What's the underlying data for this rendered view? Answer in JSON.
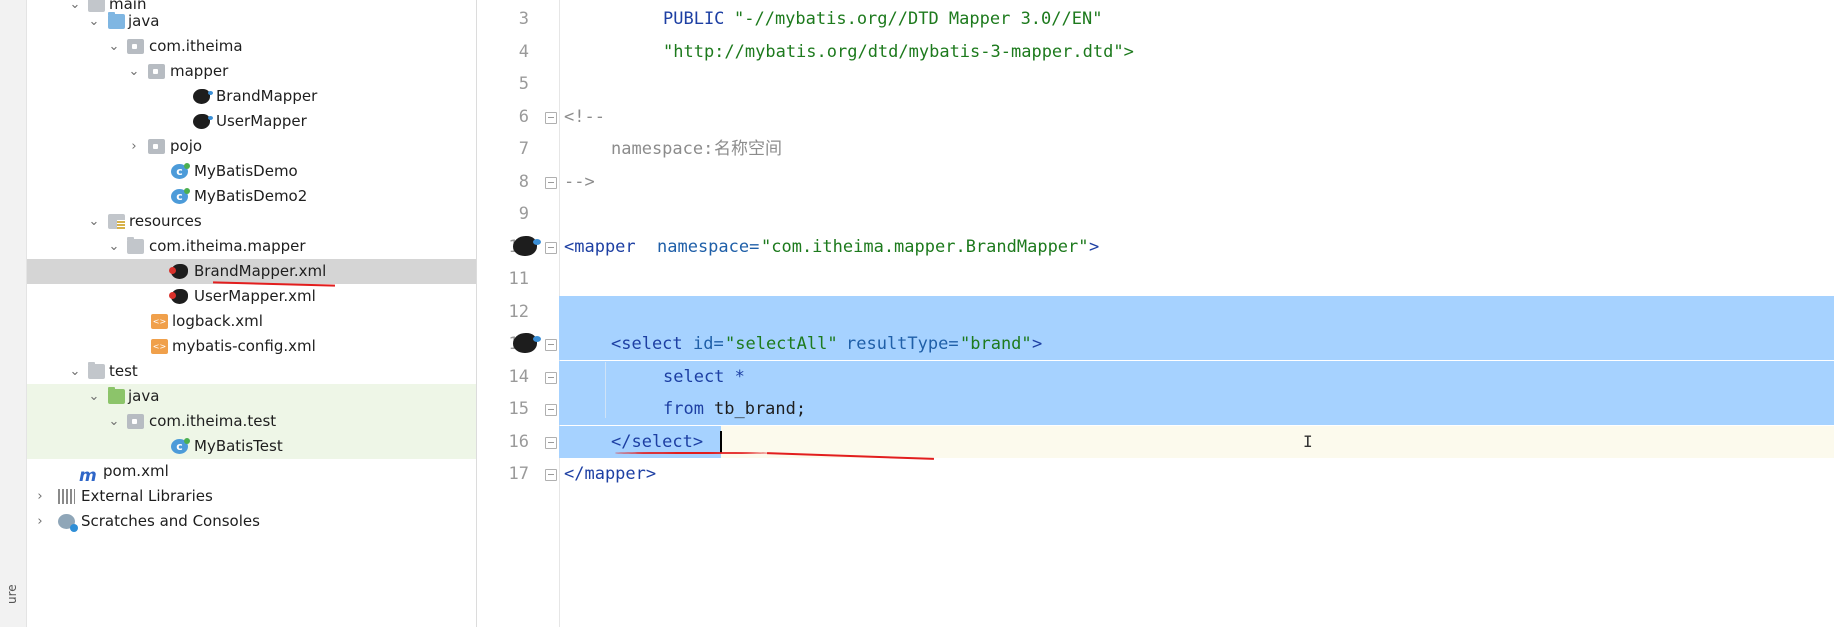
{
  "side_strip": {
    "label": "ure"
  },
  "tree": [
    {
      "label": "main",
      "depth": 0
    },
    {
      "label": "java",
      "depth": 1
    },
    {
      "label": "com.itheima",
      "depth": 2
    },
    {
      "label": "mapper",
      "depth": 3
    },
    {
      "label": "BrandMapper",
      "depth": 4
    },
    {
      "label": "UserMapper",
      "depth": 4
    },
    {
      "label": "pojo",
      "depth": 3
    },
    {
      "label": "MyBatisDemo",
      "depth": 3
    },
    {
      "label": "MyBatisDemo2",
      "depth": 3
    },
    {
      "label": "resources",
      "depth": 1
    },
    {
      "label": "com.itheima.mapper",
      "depth": 2
    },
    {
      "label": "BrandMapper.xml",
      "depth": 3,
      "selected": true
    },
    {
      "label": "UserMapper.xml",
      "depth": 3
    },
    {
      "label": "logback.xml",
      "depth": 2
    },
    {
      "label": "mybatis-config.xml",
      "depth": 2
    },
    {
      "label": "test",
      "depth": 0
    },
    {
      "label": "java",
      "depth": 1
    },
    {
      "label": "com.itheima.test",
      "depth": 2
    },
    {
      "label": "MyBatisTest",
      "depth": 3
    },
    {
      "label": "pom.xml",
      "depth": 0
    },
    {
      "label": "External Libraries",
      "depth": 0
    },
    {
      "label": "Scratches and Consoles",
      "depth": 0
    }
  ],
  "editor": {
    "lines": [
      {
        "n": "3"
      },
      {
        "n": "4"
      },
      {
        "n": "5"
      },
      {
        "n": "6"
      },
      {
        "n": "7"
      },
      {
        "n": "8"
      },
      {
        "n": "9"
      },
      {
        "n": "10"
      },
      {
        "n": "11"
      },
      {
        "n": "12"
      },
      {
        "n": "13"
      },
      {
        "n": "14"
      },
      {
        "n": "15"
      },
      {
        "n": "16"
      },
      {
        "n": "17"
      }
    ],
    "tokens": {
      "l3_public": "PUBLIC",
      "l3_str": "\"-//mybatis.org//DTD Mapper 3.0//EN\"",
      "l4_str": "\"http://mybatis.org/dtd/mybatis-3-mapper.dtd\">",
      "l6_com": "<!--",
      "l7_ns": "namespace:",
      "l7_cn": "名称空间",
      "l8_com": "-->",
      "l10_open": "<mapper",
      "l10_attr": "namespace=",
      "l10_val": "\"com.itheima.mapper.BrandMapper\"",
      "l10_close": ">",
      "l13_open": "<select",
      "l13_id": "id=",
      "l13_idv": "\"selectAll\"",
      "l13_rt": "resultType=",
      "l13_rtv": "\"brand\"",
      "l13_close": ">",
      "l14_kw": "select *",
      "l15_kw": "from",
      "l15_tb": "tb_brand;",
      "l16_close": "</select>",
      "l17_close": "</mapper>"
    }
  },
  "colors": {
    "selection": "#a6d2ff",
    "annotation": "#e21e1e",
    "tag": "#1d3fa3",
    "string": "#1d7a1d",
    "comment": "#8c8c8c"
  }
}
